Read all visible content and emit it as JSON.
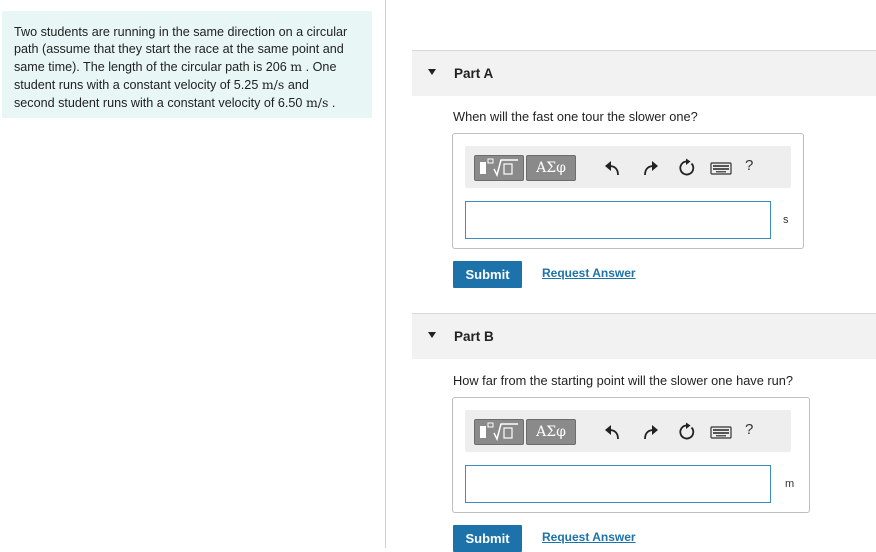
{
  "problem": {
    "line1": "Two students are running in the same direction on a circular",
    "line2": "path (assume that they start the race at the same point and",
    "line3_pre": "same time). The length of the circular path is 206",
    "line3_unit": "m",
    "line3_post": ". One",
    "line4_pre": "student runs with a constant velocity of 5.25",
    "line4_unit": "m/s",
    "line4_post": "and",
    "line5_pre": "second student runs with a constant velocity of 6.50",
    "line5_unit": "m/s",
    "line5_post": "."
  },
  "parts": [
    {
      "title": "Part A",
      "question": "When will the fast one tour the slower one?",
      "greek_label": "ΑΣφ",
      "help": "?",
      "unit": "s",
      "submit": "Submit",
      "request": "Request Answer"
    },
    {
      "title": "Part B",
      "question": "How far from the starting point will the slower one have run?",
      "greek_label": "ΑΣφ",
      "help": "?",
      "unit": "m",
      "submit": "Submit",
      "request": "Request Answer"
    }
  ],
  "colors": {
    "accent": "#1d73a9",
    "problem_bg": "#e8f6f5",
    "input_border": "#3b8dbf"
  }
}
